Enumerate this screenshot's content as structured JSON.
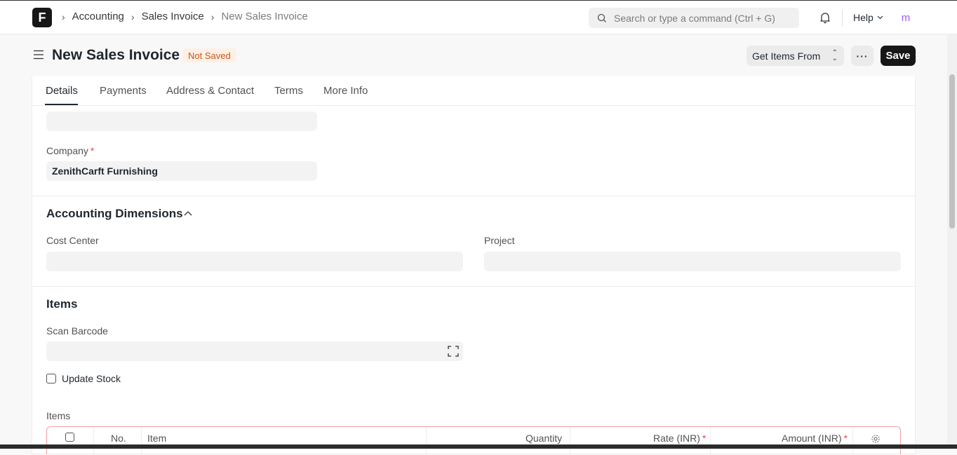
{
  "navbar": {
    "logo_letter": "F",
    "breadcrumbs": [
      "Accounting",
      "Sales Invoice",
      "New Sales Invoice"
    ],
    "search_placeholder": "Search or type a command (Ctrl + G)",
    "help_label": "Help",
    "avatar_letter": "m"
  },
  "page": {
    "title": "New Sales Invoice",
    "status_badge": "Not Saved",
    "get_items_label": "Get Items From",
    "more_label": "···",
    "save_label": "Save"
  },
  "tabs": [
    "Details",
    "Payments",
    "Address & Contact",
    "Terms",
    "More Info"
  ],
  "form": {
    "company_label": "Company",
    "company_value": "ZenithCarft Furnishing",
    "accounting_dimensions_title": "Accounting Dimensions",
    "cost_center_label": "Cost Center",
    "project_label": "Project",
    "items_section_title": "Items",
    "scan_barcode_label": "Scan Barcode",
    "update_stock_label": "Update Stock",
    "items_table_label": "Items",
    "required_marker": "*"
  },
  "items_table": {
    "columns": [
      "No.",
      "Item",
      "Quantity",
      "Rate (INR)",
      "Amount (INR)"
    ]
  },
  "colors": {
    "primary_button": "#171717",
    "badge_bg": "#fff0e6",
    "badge_text": "#c4561b",
    "required": "#e24c4c",
    "avatar": "#9c5ee6"
  }
}
